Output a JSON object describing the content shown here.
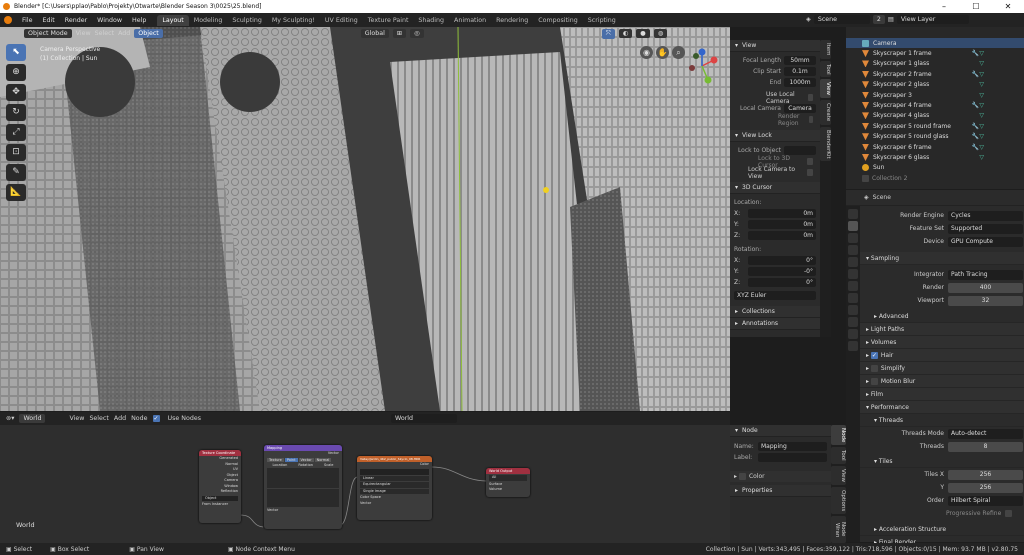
{
  "window": {
    "title": "Blender* [C:\\Users\\pplao\\Pablo\\Projekty\\Otwarte\\Blender Season 3\\0025\\25.blend]",
    "min": "–",
    "max": "☐",
    "close": "✕"
  },
  "menu": [
    "File",
    "Edit",
    "Render",
    "Window",
    "Help"
  ],
  "workspaces": [
    "Layout",
    "Modeling",
    "Sculpting",
    "My Sculpting!",
    "UV Editing",
    "Texture Paint",
    "Shading",
    "Animation",
    "Rendering",
    "Compositing",
    "Scripting"
  ],
  "active_workspace": "Layout",
  "scene": {
    "label": "Scene",
    "count": "2",
    "view_layer": "View Layer"
  },
  "viewport": {
    "mode": "Object Mode",
    "menus": [
      "View",
      "Select",
      "Add",
      "Object"
    ],
    "orientation": "Global",
    "info_line1": "Camera Perspective",
    "info_line2": "(1) Collection | Sun"
  },
  "npanel": {
    "view_title": "View",
    "focal_label": "Focal Length",
    "focal": "50mm",
    "clip_start_label": "Clip Start",
    "clip_start": "0.1m",
    "end_label": "End",
    "end": "1000m",
    "use_local_camera": "Use Local Camera",
    "local_camera_label": "Local Camera",
    "local_camera": "Camera",
    "render_region": "Render Region",
    "view_lock_title": "View Lock",
    "lock_to_object": "Lock to Object",
    "lock_3d_cursor": "Lock to 3D Cursor",
    "lock_camera": "Lock Camera to View",
    "cursor_title": "3D Cursor",
    "location": "Location:",
    "rotation": "Rotation:",
    "loc": [
      {
        "a": "X:",
        "v": "0m"
      },
      {
        "a": "Y:",
        "v": "0m"
      },
      {
        "a": "Z:",
        "v": "0m"
      }
    ],
    "rot": [
      {
        "a": "X:",
        "v": "0°"
      },
      {
        "a": "Y:",
        "v": "-0°"
      },
      {
        "a": "Z:",
        "v": "0°"
      }
    ],
    "euler": "XYZ Euler",
    "collections": "Collections",
    "annotations": "Annotations",
    "tabs": [
      "Item",
      "Tool",
      "View",
      "Create",
      "BlenderKit"
    ]
  },
  "outliner": {
    "items": [
      {
        "name": "Camera",
        "icon": "camera-icon",
        "sel": true
      },
      {
        "name": "Skyscraper 1 frame",
        "icon": "mesh-icon"
      },
      {
        "name": "Skyscraper 1 glass",
        "icon": "mesh-icon"
      },
      {
        "name": "Skyscraper 2 frame",
        "icon": "mesh-icon"
      },
      {
        "name": "Skyscraper 2 glass",
        "icon": "mesh-icon"
      },
      {
        "name": "Skyscraper 3",
        "icon": "mesh-icon"
      },
      {
        "name": "Skyscraper 4 frame",
        "icon": "mesh-icon"
      },
      {
        "name": "Skyscraper 4 glass",
        "icon": "mesh-icon"
      },
      {
        "name": "Skyscraper 5 round frame",
        "icon": "mesh-icon"
      },
      {
        "name": "Skyscraper 5 round glass",
        "icon": "mesh-icon"
      },
      {
        "name": "Skyscraper 6 frame",
        "icon": "mesh-icon"
      },
      {
        "name": "Skyscraper 6 glass",
        "icon": "mesh-icon"
      },
      {
        "name": "Sun",
        "icon": "sun-icon"
      },
      {
        "name": "Collection 2",
        "icon": "collection-icon"
      }
    ]
  },
  "properties": {
    "scene": "Scene",
    "render_engine_label": "Render Engine",
    "render_engine": "Cycles",
    "feature_set_label": "Feature Set",
    "feature_set": "Supported",
    "device_label": "Device",
    "device": "GPU Compute",
    "sampling": "Sampling",
    "integrator_label": "Integrator",
    "integrator": "Path Tracing",
    "render_label": "Render",
    "render": "400",
    "viewport_label": "Viewport",
    "viewport": "32",
    "advanced": "Advanced",
    "light_paths": "Light Paths",
    "volumes": "Volumes",
    "hair": "Hair",
    "simplify": "Simplify",
    "motion_blur": "Motion Blur",
    "film": "Film",
    "performance": "Performance",
    "threads": "Threads",
    "threads_mode_label": "Threads Mode",
    "threads_mode": "Auto-detect",
    "threads_label": "Threads",
    "threads_val": "8",
    "tiles": "Tiles",
    "tiles_x_label": "Tiles X",
    "tiles_x": "256",
    "tiles_y_label": "Y",
    "tiles_y": "256",
    "order_label": "Order",
    "order": "Hilbert Spiral",
    "progressive": "Progressive Refine",
    "accel": "Acceleration Structure",
    "final_render": "Final Render"
  },
  "node_editor": {
    "type": "World",
    "menus": [
      "View",
      "Select",
      "Add",
      "Node"
    ],
    "use_nodes": "Use Nodes",
    "world": "World",
    "label": "World",
    "nodes": {
      "tex": "Texture Coordinate",
      "tex_outs": [
        "Generated",
        "Normal",
        "UV",
        "Object",
        "Camera",
        "Window",
        "Reflection"
      ],
      "tex_obj": "Object",
      "tex_inst": "From Instancer",
      "map": "Mapping",
      "map_vec": "Vector",
      "map_tabs": [
        "Texture",
        "Point",
        "Vector",
        "Normal"
      ],
      "map_cols": [
        "Location",
        "Rotation",
        "Scale"
      ],
      "env": "Valley/Jardin_4K2_public_Skyclo_08.HDR",
      "env_out": "Color",
      "env_rows": [
        "Linear",
        "Equirectangular",
        "Single Image",
        "Color Space",
        "Vector"
      ],
      "out": "World Output",
      "out_rows": [
        "All",
        "Surface",
        "Volume"
      ]
    }
  },
  "node_panel": {
    "title": "Node",
    "name_label": "Name:",
    "name": "Mapping",
    "label_label": "Label:",
    "color": "Color",
    "properties": "Properties",
    "tabs": [
      "Node",
      "Tool",
      "View",
      "Options",
      "Node Wran"
    ]
  },
  "status": {
    "select": "Select",
    "box": "Box Select",
    "pan": "Pan View",
    "ctx": "Node Context Menu",
    "info": "Collection | Sun | Verts:343,495 | Faces:359,122 | Tris:718,596 | Objects:0/15 | Mem: 93.7 MB | v2.80.75"
  }
}
